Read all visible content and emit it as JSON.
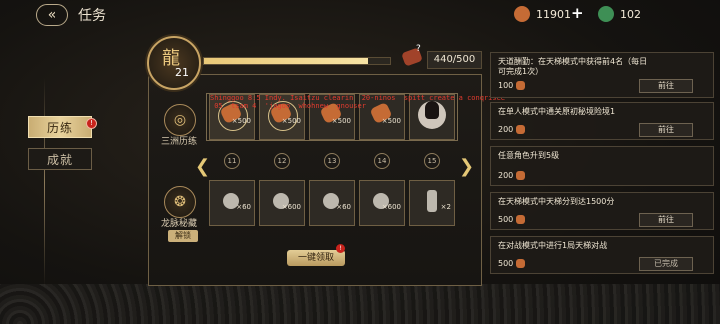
{
  "header": {
    "back_icon": "back-arrow-icon",
    "title": "任务"
  },
  "currency": {
    "gems": "11901",
    "jade": "102",
    "plus_label": "+",
    "colors": {
      "gem": "#c56b35",
      "jade": "#3e8f55"
    }
  },
  "nav": {
    "items": [
      {
        "label": "历练",
        "active": true
      },
      {
        "label": "成就",
        "active": false
      }
    ],
    "badge": "!"
  },
  "progress": {
    "level": "21",
    "xp_text": "440/500",
    "xp_fraction": 0.88,
    "help": "?"
  },
  "tracks": [
    {
      "name": "三洲历练"
    },
    {
      "name": "龙脉秘藏",
      "unlock_label": "解锁"
    }
  ],
  "rewards_top": [
    {
      "qty": "×500",
      "claimed": true
    },
    {
      "qty": "×500",
      "claimed": true
    },
    {
      "qty": "×500",
      "claimed": false
    },
    {
      "qty": "×500",
      "claimed": false
    },
    {
      "qty": "",
      "claimed": false
    }
  ],
  "rewards_bottom": [
    {
      "qty": "×60"
    },
    {
      "qty": "×600"
    },
    {
      "qty": "×60"
    },
    {
      "qty": "×600"
    },
    {
      "qty": "×2"
    }
  ],
  "levels": [
    "11",
    "12",
    "13",
    "14",
    "15"
  ],
  "claim_all": {
    "label": "一键领取",
    "badge": "!"
  },
  "overlay_text": "Shinggoo 8:5 Indy. Isaitzu clearin  20-ninos  spitt create a conqrisee\n 05  tsam 4  'jagoo  whohnew  gnouser  ",
  "quests": [
    {
      "text": "天道酬勤：在天梯模式中获得前4名（每日可完成1次）",
      "reward": "100",
      "button": "前往"
    },
    {
      "text": "在单人模式中通关原初秘境险境1",
      "reward": "200",
      "button": "前往"
    },
    {
      "text": "任意角色升到5级",
      "reward": "200",
      "button": ""
    },
    {
      "text": "在天梯模式中天梯分到达1500分",
      "reward": "500",
      "button": "前往"
    },
    {
      "text": "在对战模式中进行1局天梯对战",
      "reward": "500",
      "button": "已完成"
    }
  ]
}
